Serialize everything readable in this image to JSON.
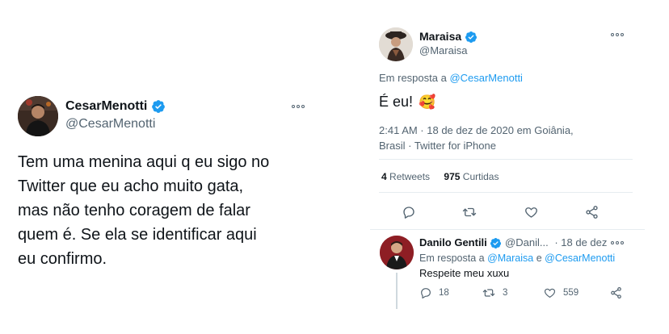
{
  "left_tweet": {
    "name": "CesarMenotti",
    "handle": "@CesarMenotti",
    "text_lines": [
      "Tem uma menina aqui q eu sigo no",
      "Twitter que eu acho muito gata,",
      "mas não tenho coragem de falar",
      "quem é. Se ela se identificar aqui",
      "eu confirmo."
    ]
  },
  "right_tweet": {
    "name": "Maraisa",
    "handle": "@Maraisa",
    "reply_prefix": "Em resposta a ",
    "reply_to": "@CesarMenotti",
    "text": "É eu!",
    "emoji": "🥰",
    "time_line1": "2:41 AM · 18 de dez de 2020 em Goiânia,",
    "time_line2": "Brasil · Twitter for iPhone",
    "retweets_count": "4",
    "retweets_label": "Retweets",
    "likes_count": "975",
    "likes_label": "Curtidas"
  },
  "reply": {
    "name": "Danilo Gentili",
    "handle": "@Danil...",
    "date": "· 18 de dez",
    "reply_prefix": "Em resposta a ",
    "reply_to_1": "@Maraisa",
    "reply_mid": " e ",
    "reply_to_2": "@CesarMenotti",
    "text": "Respeite meu xuxu",
    "replies": "18",
    "retweets": "3",
    "likes": "559"
  },
  "colors": {
    "accent": "#1d9bf0",
    "text": "#0f1419",
    "secondary": "#536471",
    "divider": "#e6ecf0"
  }
}
